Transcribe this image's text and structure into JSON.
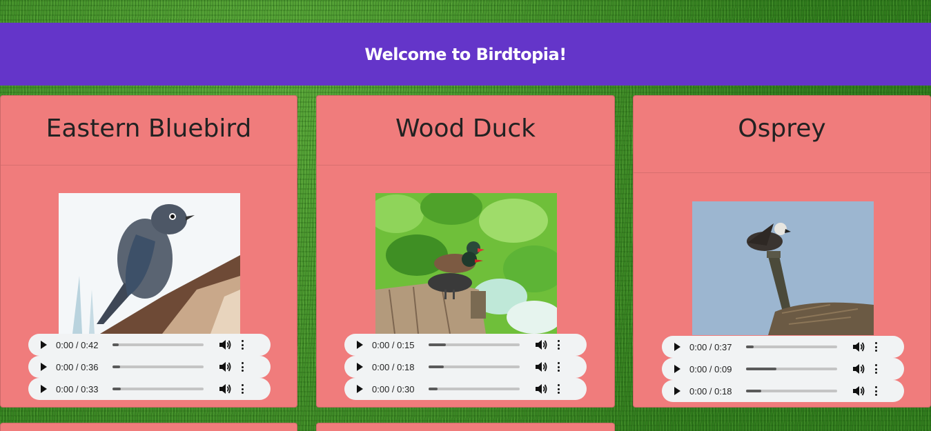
{
  "header": {
    "title": "Welcome to Birdtopia!"
  },
  "colors": {
    "header_bg": "#6435c9",
    "card_bg": "#f07c7c",
    "player_bg": "#f1f3f4"
  },
  "cards": [
    {
      "name": "Eastern Bluebird",
      "image_icon": "bluebird-photo",
      "players": [
        {
          "time": "0:00 / 0:42",
          "progress": 0.07
        },
        {
          "time": "0:00 / 0:36",
          "progress": 0.08
        },
        {
          "time": "0:00 / 0:33",
          "progress": 0.09
        }
      ]
    },
    {
      "name": "Wood Duck",
      "image_icon": "wood-duck-photo",
      "players": [
        {
          "time": "0:00 / 0:15",
          "progress": 0.19
        },
        {
          "time": "0:00 / 0:18",
          "progress": 0.17
        },
        {
          "time": "0:00 / 0:30",
          "progress": 0.1
        }
      ]
    },
    {
      "name": "Osprey",
      "image_icon": "osprey-photo",
      "players": [
        {
          "time": "0:00 / 0:37",
          "progress": 0.08
        },
        {
          "time": "0:00 / 0:09",
          "progress": 0.33
        },
        {
          "time": "0:00 / 0:18",
          "progress": 0.17
        }
      ]
    }
  ]
}
